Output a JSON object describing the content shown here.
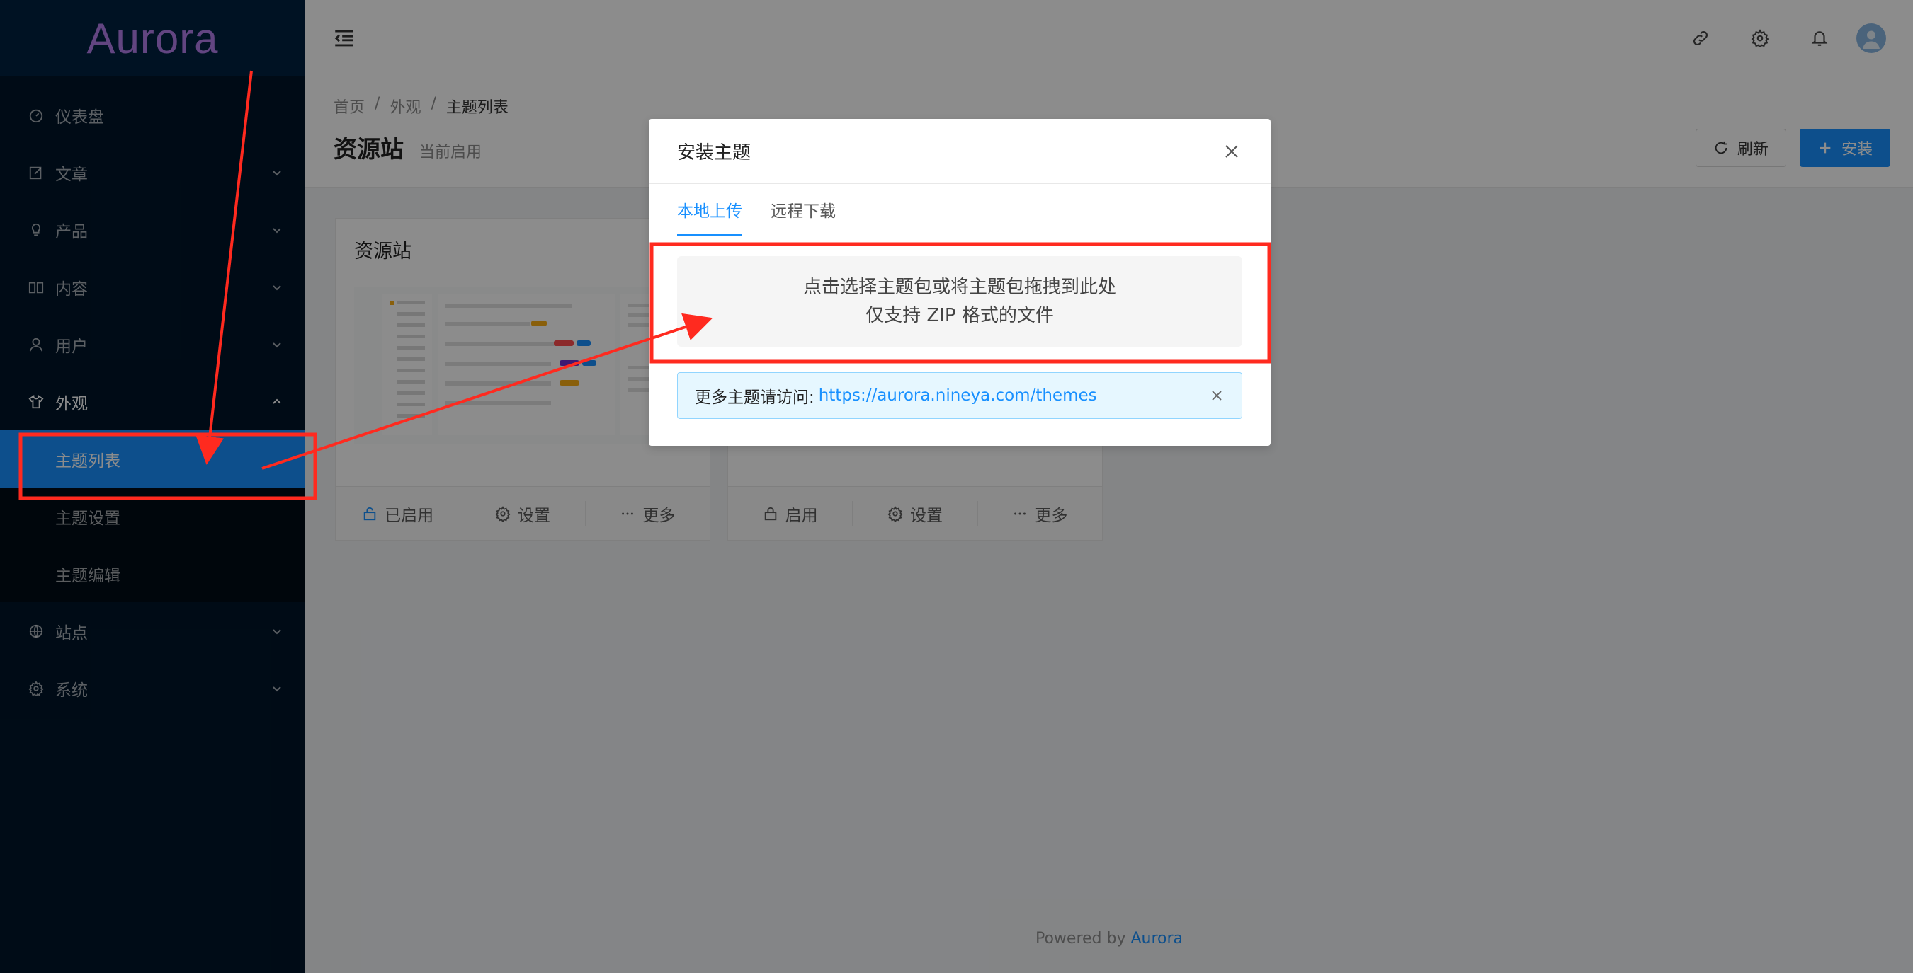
{
  "app": {
    "logo": "Aurora"
  },
  "sidebar": {
    "items": [
      {
        "label": "仪表盘",
        "icon": "dashboard-icon"
      },
      {
        "label": "文章",
        "icon": "edit-icon"
      },
      {
        "label": "产品",
        "icon": "bulb-icon"
      },
      {
        "label": "内容",
        "icon": "book-icon"
      },
      {
        "label": "用户",
        "icon": "user-icon"
      },
      {
        "label": "外观",
        "icon": "skin-icon"
      },
      {
        "label": "站点",
        "icon": "global-icon"
      },
      {
        "label": "系统",
        "icon": "setting-icon"
      }
    ],
    "appearance_sub": [
      "主题列表",
      "主题设置",
      "主题编辑"
    ]
  },
  "breadcrumb": [
    "首页",
    "外观",
    "主题列表"
  ],
  "page": {
    "title": "资源站",
    "subtitle": "当前启用",
    "refresh_label": "刷新",
    "install_label": "安装"
  },
  "cards": [
    {
      "title": "资源站",
      "actions": [
        "已启用",
        "设置",
        "更多"
      ]
    },
    {
      "title": "",
      "actions": [
        "启用",
        "设置",
        "更多"
      ]
    }
  ],
  "footer": {
    "prefix": "Powered by",
    "brand": "Aurora"
  },
  "modal": {
    "title": "安装主题",
    "tabs": [
      "本地上传",
      "远程下载"
    ],
    "upload_line1": "点击选择主题包或将主题包拖拽到此处",
    "upload_line2": "仅支持 ZIP 格式的文件",
    "alert_label": "更多主题请访问:",
    "alert_link": "https://aurora.nineya.com/themes"
  },
  "colors": {
    "primary": "#1890ff",
    "sidebar": "#001529",
    "annotation": "#ff2a1f",
    "logo": "#b37feb"
  }
}
